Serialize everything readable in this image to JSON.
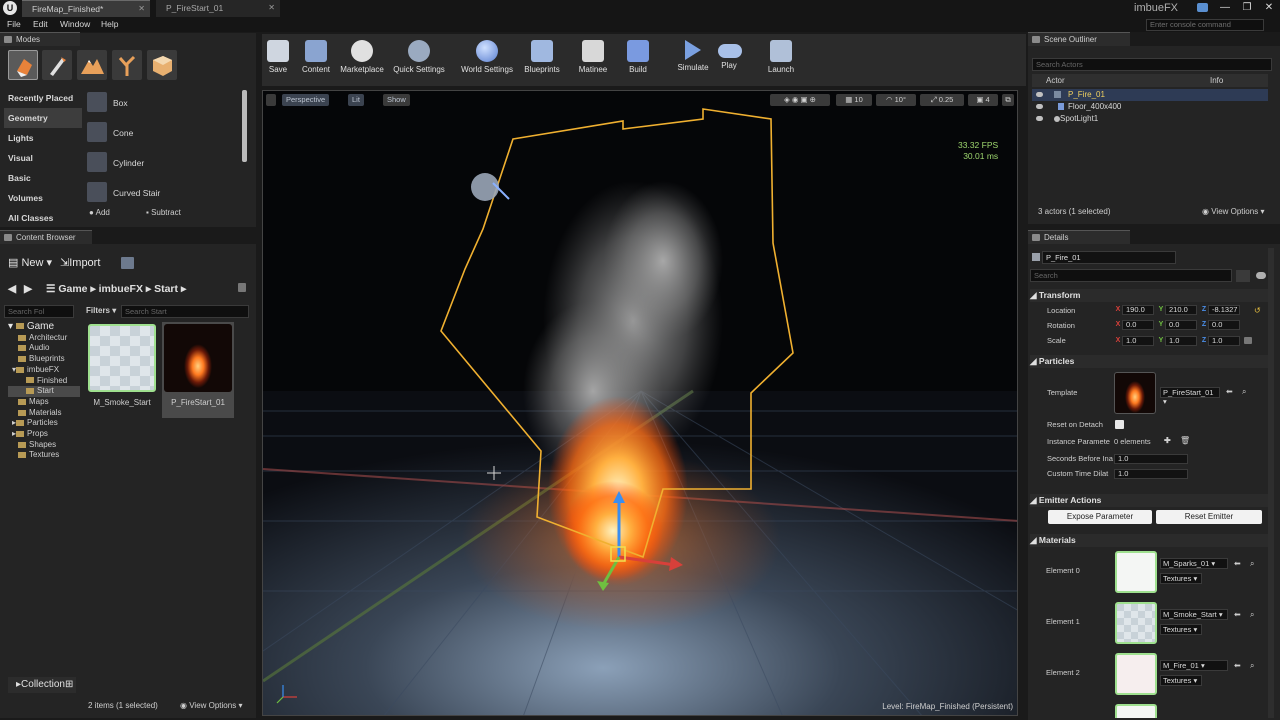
{
  "window": {
    "tabs": [
      {
        "label": "FireMap_Finished*"
      },
      {
        "label": "P_FireStart_01"
      }
    ],
    "app_name": "imbueFX",
    "logo": "U"
  },
  "menu": [
    "File",
    "Edit",
    "Window",
    "Help"
  ],
  "console": {
    "placeholder": "Enter console command"
  },
  "modes": {
    "title": "Modes",
    "categories": [
      "Recently Placed",
      "Geometry",
      "Lights",
      "Visual",
      "Basic",
      "Volumes",
      "All Classes"
    ],
    "selected_category": "Geometry",
    "items": [
      "Box",
      "Cone",
      "Cylinder",
      "Curved Stair"
    ],
    "add_label": "Add",
    "subtract_label": "Subtract"
  },
  "content_browser": {
    "title": "Content Browser",
    "new_label": "New",
    "import_label": "Import",
    "path": [
      "Game",
      "imbueFX",
      "Start"
    ],
    "search_folders": "Search Fol",
    "filters_label": "Filters",
    "search_placeholder": "Search Start",
    "tree": [
      "Game",
      "Architectur",
      "Audio",
      "Blueprints",
      "imbueFX",
      "Finished",
      "Start",
      "Maps",
      "Materials",
      "Particles",
      "Props",
      "Shapes",
      "Textures"
    ],
    "assets": [
      {
        "name": "M_Smoke_Start"
      },
      {
        "name": "P_FireStart_01"
      }
    ],
    "collections_label": "Collection",
    "status": "2 items (1 selected)",
    "view_options": "View Options"
  },
  "toolbar": {
    "items": [
      "Save",
      "Content",
      "Marketplace",
      "Quick Settings",
      "World Settings",
      "Blueprints",
      "Matinee",
      "Build",
      "Simulate",
      "Play",
      "Launch"
    ]
  },
  "viewport": {
    "perspective": "Perspective",
    "lit": "Lit",
    "show": "Show",
    "grid_size": "10",
    "rotation_snap": "10°",
    "scale_snap": "0.25",
    "camera_speed": "4",
    "fps": "33.32 FPS",
    "ms": "30.01 ms",
    "level_label": "Level:",
    "level": "FireMap_Finished (Persistent)"
  },
  "outliner": {
    "title": "Scene Outliner",
    "search_placeholder": "Search Actors",
    "col_actor": "Actor",
    "col_info": "Info",
    "actors": [
      {
        "name": "P_Fire_01"
      },
      {
        "name": "Floor_400x400"
      },
      {
        "name": "SpotLight1"
      }
    ],
    "selected": "P_Fire_01",
    "status": "3 actors (1 selected)",
    "view_options": "View Options"
  },
  "details": {
    "title": "Details",
    "name": "P_Fire_01",
    "search_placeholder": "Search",
    "transform_label": "Transform",
    "location_label": "Location",
    "rotation_label": "Rotation",
    "scale_label": "Scale",
    "location": [
      "190.0",
      "210.0",
      "-8.1327"
    ],
    "rotation": [
      "0.0",
      "0.0",
      "0.0"
    ],
    "scale": [
      "1.0",
      "1.0",
      "1.0"
    ],
    "axis": [
      "X",
      "Y",
      "Z"
    ],
    "particles_label": "Particles",
    "template_label": "Template",
    "template_value": "P_FireStart_01",
    "reset_on_detach_label": "Reset on Detach",
    "instance_params_label": "Instance Paramete",
    "instance_params_value": "0 elements",
    "seconds_label": "Seconds Before Ina",
    "seconds_value": "1.0",
    "custom_time_label": "Custom Time Dilat",
    "custom_time_value": "1.0",
    "emitter_actions_label": "Emitter Actions",
    "expose_param_label": "Expose Parameter",
    "reset_emitter_label": "Reset Emitter",
    "materials_label": "Materials",
    "materials": [
      {
        "element": "Element 0",
        "name": "M_Sparks_01",
        "textures": "Textures"
      },
      {
        "element": "Element 1",
        "name": "M_Smoke_Start",
        "textures": "Textures"
      },
      {
        "element": "Element 2",
        "name": "M_Fire_01",
        "textures": "Textures"
      }
    ]
  },
  "colors": {
    "accent": "#f0b030",
    "x_axis": "#d8403a",
    "y_axis": "#6fc040",
    "z_axis": "#4a8ee8"
  }
}
